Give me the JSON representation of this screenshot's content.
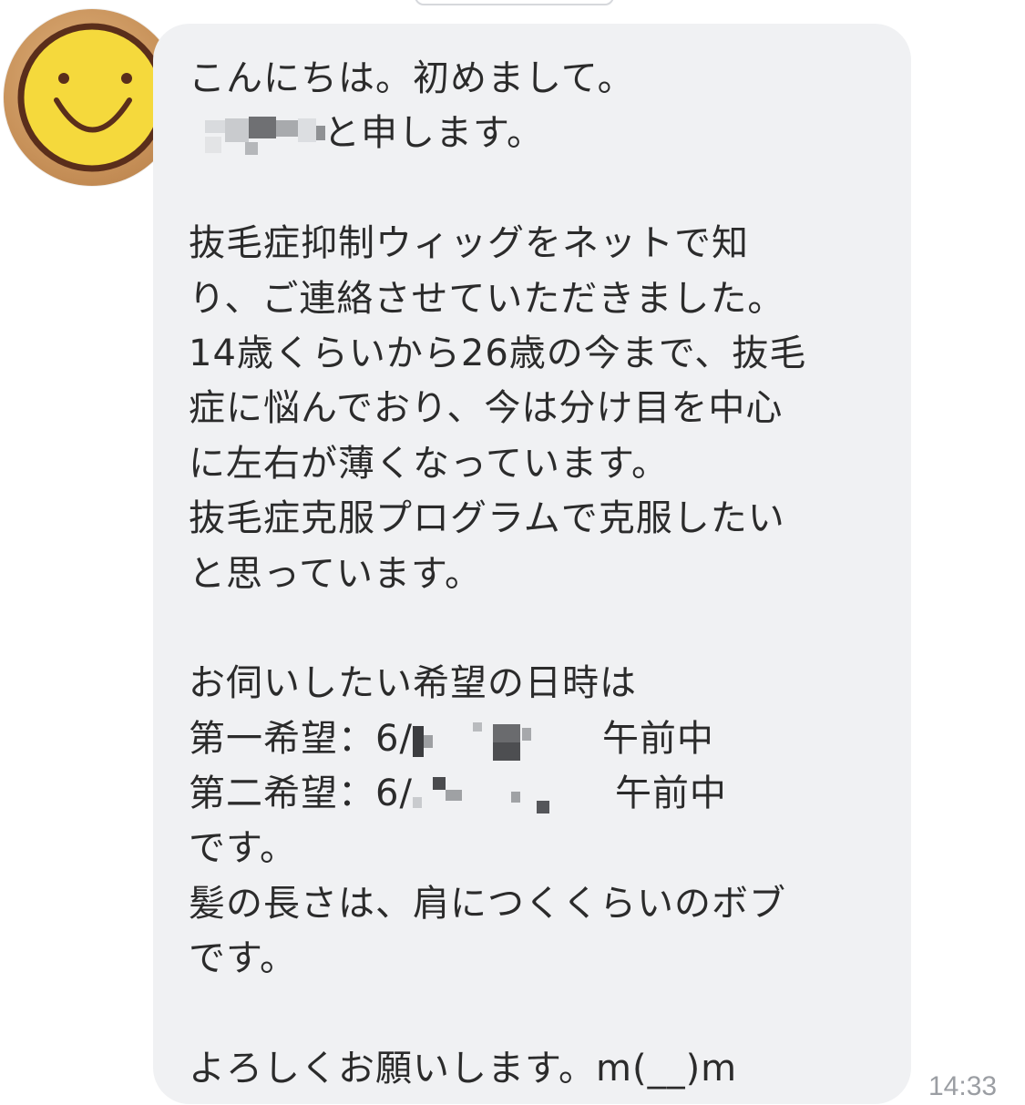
{
  "chat": {
    "message": {
      "lines": [
        "こんにちは。初めまして。",
        "と申します。",
        "",
        "抜毛症抑制ウィッグをネットで知",
        "り、ご連絡させていただきました。",
        "14歳くらいから26歳の今まで、抜毛",
        "症に悩んでおり、今は分け目を中心",
        "に左右が薄くなっています。",
        "抜毛症克服プログラムで克服したい",
        "と思っています。",
        "",
        "お伺いしたい希望の日時は",
        "第一希望：6/",
        "第二希望：6/",
        "です。",
        "髪の長さは、肩につくくらいのボブ",
        "です。",
        "",
        "よろしくお願いします。m(__)m"
      ],
      "time_suffix": "午前中",
      "timestamp": "14:33"
    },
    "avatar": {
      "icon": "smiley-face-icon",
      "face_color": "#f5d93c",
      "rim_color": "#5a2e1b",
      "frame_color": "#c8925a"
    },
    "colors": {
      "bubble": "#f0f1f3",
      "text": "#2b2b2b",
      "timestamp": "#9b9ea3"
    }
  }
}
